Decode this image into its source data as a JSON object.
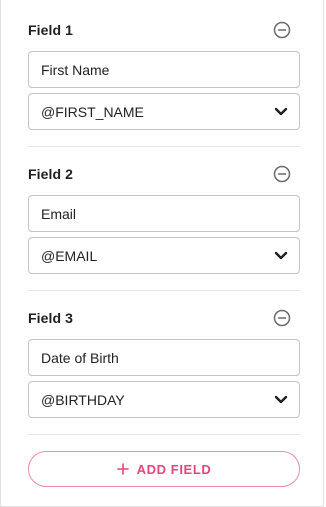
{
  "fields": [
    {
      "title": "Field 1",
      "input_value": "First Name",
      "select_value": "@FIRST_NAME"
    },
    {
      "title": "Field 2",
      "input_value": "Email",
      "select_value": "@EMAIL"
    },
    {
      "title": "Field 3",
      "input_value": "Date of Birth",
      "select_value": "@BIRTHDAY"
    }
  ],
  "icons": {
    "remove": "minus-circle-icon",
    "dropdown": "chevron-down-icon",
    "add": "plus-icon"
  },
  "add_button": {
    "label": "ADD FIELD"
  },
  "colors": {
    "accent": "#e8457a",
    "accent_border": "#ef8aa7",
    "input_border": "#c4c4c4",
    "divider": "#e4e4e4",
    "text": "#222222",
    "icon": "#6b6b6b"
  }
}
